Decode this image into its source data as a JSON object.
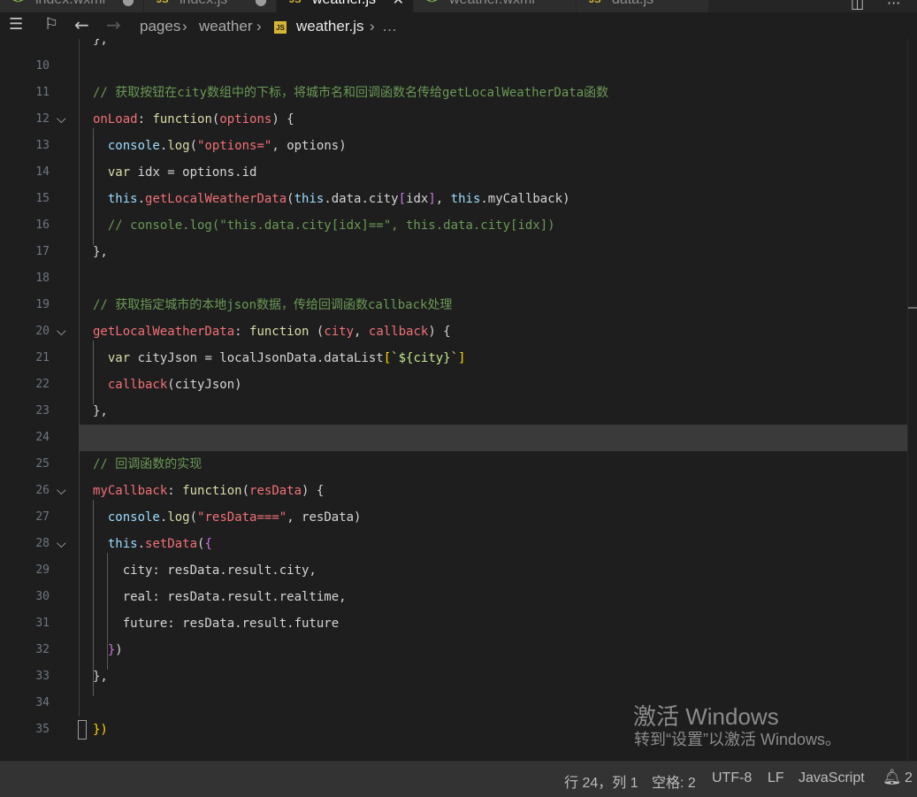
{
  "tabs": [
    {
      "label": "index.wxml",
      "icon": "wxml-icon",
      "color": "#8bc34a",
      "active": false
    },
    {
      "label": "index.js",
      "icon": "js-icon",
      "color": "#d6b533",
      "active": false
    },
    {
      "label": "weather.js",
      "icon": "js-icon",
      "color": "#d6b533",
      "active": true
    },
    {
      "label": "weather.wxml",
      "icon": "wxml-icon",
      "color": "#8bc34a",
      "active": false
    },
    {
      "label": "data.js",
      "icon": "js-icon",
      "color": "#d6b533",
      "active": false
    }
  ],
  "breadcrumb": {
    "seg1": "pages",
    "seg2": "weather",
    "file": "weather.js",
    "more": "…",
    "js_badge": "JS"
  },
  "editor": {
    "lines": [
      {
        "n": "",
        "fold": false,
        "tokens": [
          {
            "c": "tx",
            "t": "},"
          }
        ]
      },
      {
        "n": "10",
        "fold": false,
        "tokens": []
      },
      {
        "n": "11",
        "fold": false,
        "tokens": [
          {
            "c": "cm",
            "t": "// 获取按钮在city数组中的下标，将城市名和回调函数名传给getLocalWeatherData函数"
          }
        ]
      },
      {
        "n": "12",
        "fold": true,
        "tokens": [
          {
            "c": "prm",
            "t": "onLoad"
          },
          {
            "c": "tx",
            "t": ": "
          },
          {
            "c": "pr",
            "t": "function"
          },
          {
            "c": "tx",
            "t": "("
          },
          {
            "c": "prm",
            "t": "options"
          },
          {
            "c": "tx",
            "t": ") {"
          }
        ]
      },
      {
        "n": "13",
        "fold": false,
        "tokens": [
          {
            "c": "tx",
            "t": "  "
          },
          {
            "c": "th",
            "t": "console"
          },
          {
            "c": "tx",
            "t": "."
          },
          {
            "c": "pr",
            "t": "log"
          },
          {
            "c": "tx",
            "t": "("
          },
          {
            "c": "prm",
            "t": "\"options=\""
          },
          {
            "c": "tx",
            "t": ", options)"
          }
        ]
      },
      {
        "n": "14",
        "fold": false,
        "tokens": [
          {
            "c": "tx",
            "t": "  "
          },
          {
            "c": "pr",
            "t": "var"
          },
          {
            "c": "tx",
            "t": " idx = options.id"
          }
        ]
      },
      {
        "n": "15",
        "fold": false,
        "tokens": [
          {
            "c": "tx",
            "t": "  "
          },
          {
            "c": "th",
            "t": "this"
          },
          {
            "c": "tx",
            "t": "."
          },
          {
            "c": "prm",
            "t": "getLocalWeatherData"
          },
          {
            "c": "tx",
            "t": "("
          },
          {
            "c": "th",
            "t": "this"
          },
          {
            "c": "tx",
            "t": ".data.city"
          },
          {
            "c": "pu",
            "t": "["
          },
          {
            "c": "tx",
            "t": "idx"
          },
          {
            "c": "pu",
            "t": "]"
          },
          {
            "c": "tx",
            "t": ", "
          },
          {
            "c": "th",
            "t": "this"
          },
          {
            "c": "tx",
            "t": ".myCallback)"
          }
        ]
      },
      {
        "n": "16",
        "fold": false,
        "tokens": [
          {
            "c": "tx",
            "t": "  "
          },
          {
            "c": "cm",
            "t": "// console.log(\"this.data.city[idx]==\", this.data.city[idx])"
          }
        ]
      },
      {
        "n": "17",
        "fold": false,
        "tokens": [
          {
            "c": "tx",
            "t": "},"
          }
        ]
      },
      {
        "n": "18",
        "fold": false,
        "tokens": []
      },
      {
        "n": "19",
        "fold": false,
        "tokens": [
          {
            "c": "cm",
            "t": "// 获取指定城市的本地json数据，传给回调函数callback处理"
          }
        ]
      },
      {
        "n": "20",
        "fold": true,
        "tokens": [
          {
            "c": "prm",
            "t": "getLocalWeatherData"
          },
          {
            "c": "tx",
            "t": ": "
          },
          {
            "c": "pr",
            "t": "function"
          },
          {
            "c": "tx",
            "t": " ("
          },
          {
            "c": "prm",
            "t": "city"
          },
          {
            "c": "tx",
            "t": ", "
          },
          {
            "c": "prm",
            "t": "callback"
          },
          {
            "c": "tx",
            "t": ") {"
          }
        ]
      },
      {
        "n": "21",
        "fold": false,
        "tokens": [
          {
            "c": "tx",
            "t": "  "
          },
          {
            "c": "pr",
            "t": "var"
          },
          {
            "c": "tx",
            "t": " cityJson = localJsonData.dataList"
          },
          {
            "c": "yl",
            "t": "["
          },
          {
            "c": "gr",
            "t": "`${city}`"
          },
          {
            "c": "yl",
            "t": "]"
          }
        ]
      },
      {
        "n": "22",
        "fold": false,
        "tokens": [
          {
            "c": "tx",
            "t": "  "
          },
          {
            "c": "prm",
            "t": "callback"
          },
          {
            "c": "tx",
            "t": "(cityJson)"
          }
        ]
      },
      {
        "n": "23",
        "fold": false,
        "tokens": [
          {
            "c": "tx",
            "t": "},"
          }
        ]
      },
      {
        "n": "24",
        "fold": false,
        "current": true,
        "tokens": []
      },
      {
        "n": "25",
        "fold": false,
        "tokens": [
          {
            "c": "cm",
            "t": "// 回调函数的实现"
          }
        ]
      },
      {
        "n": "26",
        "fold": true,
        "tokens": [
          {
            "c": "prm",
            "t": "myCallback"
          },
          {
            "c": "tx",
            "t": ": "
          },
          {
            "c": "pr",
            "t": "function"
          },
          {
            "c": "tx",
            "t": "("
          },
          {
            "c": "prm",
            "t": "resData"
          },
          {
            "c": "tx",
            "t": ") {"
          }
        ]
      },
      {
        "n": "27",
        "fold": false,
        "tokens": [
          {
            "c": "tx",
            "t": "  "
          },
          {
            "c": "th",
            "t": "console"
          },
          {
            "c": "tx",
            "t": "."
          },
          {
            "c": "pr",
            "t": "log"
          },
          {
            "c": "tx",
            "t": "("
          },
          {
            "c": "prm",
            "t": "\"resData===\""
          },
          {
            "c": "tx",
            "t": ", resData)"
          }
        ]
      },
      {
        "n": "28",
        "fold": true,
        "tokens": [
          {
            "c": "tx",
            "t": "  "
          },
          {
            "c": "th",
            "t": "this"
          },
          {
            "c": "tx",
            "t": "."
          },
          {
            "c": "prm",
            "t": "setData"
          },
          {
            "c": "tx",
            "t": "("
          },
          {
            "c": "pu",
            "t": "{"
          }
        ]
      },
      {
        "n": "29",
        "fold": false,
        "tokens": [
          {
            "c": "tx",
            "t": "    city: resData.result.city,"
          }
        ]
      },
      {
        "n": "30",
        "fold": false,
        "tokens": [
          {
            "c": "tx",
            "t": "    real: resData.result.realtime,"
          }
        ]
      },
      {
        "n": "31",
        "fold": false,
        "tokens": [
          {
            "c": "tx",
            "t": "    future: resData.result.future"
          }
        ]
      },
      {
        "n": "32",
        "fold": false,
        "tokens": [
          {
            "c": "tx",
            "t": "  "
          },
          {
            "c": "pu",
            "t": "}"
          },
          {
            "c": "tx",
            "t": ")"
          }
        ]
      },
      {
        "n": "33",
        "fold": false,
        "tokens": [
          {
            "c": "tx",
            "t": "},"
          }
        ]
      },
      {
        "n": "34",
        "fold": false,
        "tokens": []
      },
      {
        "n": "35",
        "fold": false,
        "tokens": [
          {
            "c": "yl",
            "t": "})"
          }
        ]
      }
    ]
  },
  "watermark": {
    "title": "激活 Windows",
    "subtitle": "转到“设置”以激活 Windows。"
  },
  "status": {
    "cursor": "行 24，列 1",
    "spaces": "空格: 2",
    "encoding": "UTF-8",
    "eol": "LF",
    "language": "JavaScript",
    "notifications": "2"
  },
  "colors": {
    "background": "#1e1e1e",
    "statusbar": "#333333",
    "comment": "#6a9955",
    "keyword": "#dcdcaa",
    "property": "#f07178"
  }
}
